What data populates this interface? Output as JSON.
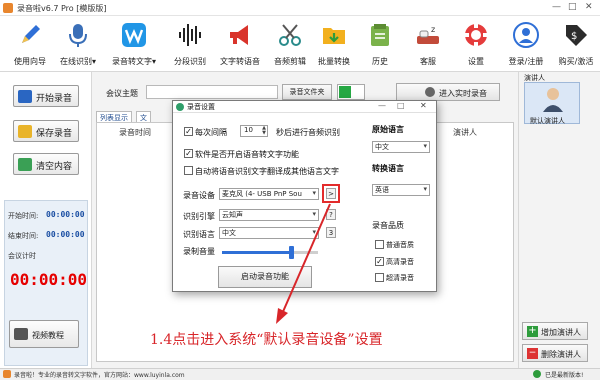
{
  "window": {
    "title": "录音啦v6.7 Pro [模版版]",
    "controls": [
      "—",
      "□",
      "✕"
    ]
  },
  "toolbar": [
    {
      "label": "使用向导",
      "icon": "pen-icon"
    },
    {
      "label": "在线识别",
      "icon": "microphone-icon",
      "dropdown": "▾"
    },
    {
      "label": "录音转文字",
      "icon": "w-letter-icon",
      "dropdown": "▾"
    },
    {
      "label": "分段识别",
      "icon": "waveform-icon"
    },
    {
      "label": "文字转语音",
      "icon": "megaphone-icon"
    },
    {
      "label": "音频剪辑",
      "icon": "scissors-icon"
    },
    {
      "label": "批量转换",
      "icon": "folder-icon"
    },
    {
      "label": "历史",
      "icon": "history-icon"
    },
    {
      "label": "客服",
      "icon": "customer-service-icon"
    },
    {
      "label": "设置",
      "icon": "lifebuoy-icon"
    },
    {
      "label": "登录/注册",
      "icon": "user-icon"
    },
    {
      "label": "购买/激活",
      "icon": "price-tag-icon"
    }
  ],
  "left_panel": {
    "buttons": [
      "开始录音",
      "保存录音",
      "清空内容"
    ],
    "start_time_label": "开始时间:",
    "start_time_value": "00:00:00",
    "end_time_label": "结束时间:",
    "end_time_value": "00:00:00",
    "timer_label": "会议计时",
    "timer_value": "00:00:00",
    "video_tutorial": "视频教程"
  },
  "main": {
    "subject_label": "会议主题",
    "file_button": "录音文件夹",
    "realtime_button": "进入实时录音",
    "tabs": [
      "列表显示",
      "文"
    ],
    "columns": [
      "录音时间",
      "演讲人"
    ]
  },
  "right_panel": {
    "speaker_header": "演讲人",
    "default_speaker": "默认演讲人",
    "add_speaker": "增加演讲人",
    "delete_speaker": "删除演讲人"
  },
  "dialog": {
    "title": "录音设置",
    "interval_prefix": "每次间隔",
    "interval_value": "10",
    "interval_suffix": "秒后进行音频识别",
    "opt_realtime_transcribe": "软件是否开启语音转文字功能",
    "opt_auto_translate": "自动将语音识别文字翻译成其他语言文字",
    "device_label": "录音设备",
    "device_value": "麦克风 (4- USB PnP Sou",
    "device_arrow": ">",
    "engine_label": "识别引擎",
    "engine_value": "云知声",
    "recog_lang_label": "识别语言",
    "recog_lang_value": "中文",
    "volume_label": "录制音量",
    "volume_level": 0.72,
    "auto_record_button": "启动录音功能",
    "help_1": "?",
    "help_2": "3",
    "source_lang_title": "原始语言",
    "source_lang_value": "中文",
    "target_lang_title": "转换语言",
    "target_lang_value": "英语",
    "quality_title": "录音品质",
    "quality_options": [
      {
        "label": "普通音质",
        "checked": false
      },
      {
        "label": "高清录音",
        "checked": true
      },
      {
        "label": "超清录音",
        "checked": false
      }
    ]
  },
  "annotation": {
    "text": "1.4点击进入系统“默认录音设备”设置",
    "color": "#d8262a"
  },
  "status_bar": {
    "left": "录音啦！专业的录音转文字软件，官方网站：www.luyinla.com",
    "right": "已是最新版本!"
  },
  "colors": {
    "accent_blue": "#1b4fa3",
    "timer_red": "#e60000",
    "toggle_green": "#26a844",
    "highlight_red": "#e32b2b"
  }
}
